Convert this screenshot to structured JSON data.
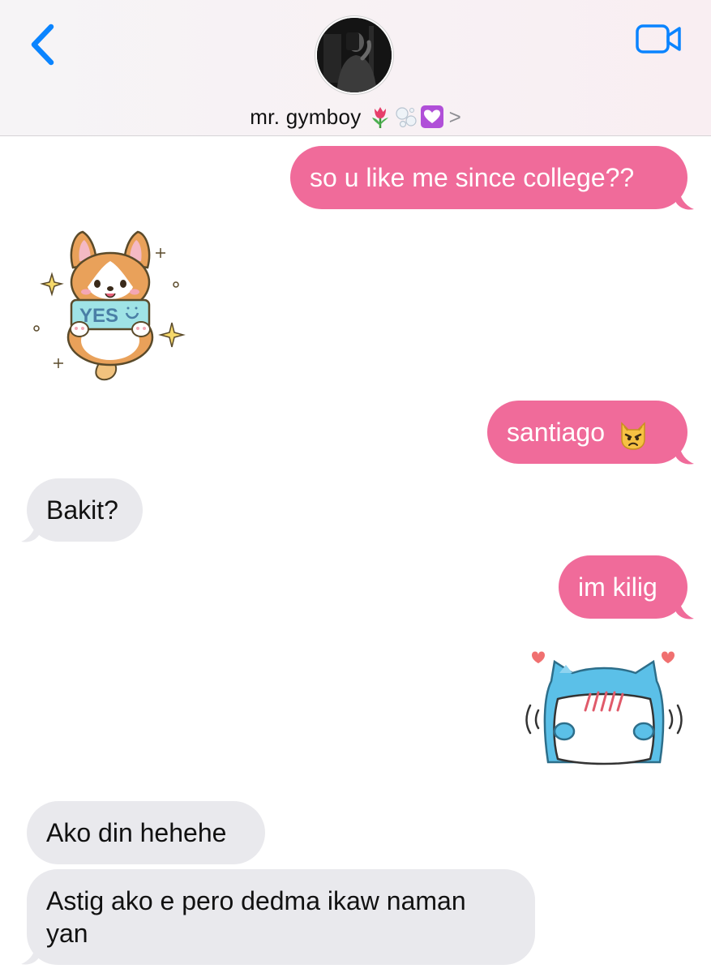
{
  "header": {
    "back_icon": "chevron-left-icon",
    "video_icon": "video-camera-icon",
    "contact_name": "mr. gymboy",
    "contact_emoji_icons": [
      "tulip-icon",
      "bubbles-icon",
      "heart-decoration-icon"
    ],
    "contact_chevron": ">"
  },
  "colors": {
    "sent_bubble": "#f06b9a",
    "received_bubble": "#e9e9ed",
    "accent_blue": "#0a84ff"
  },
  "messages": [
    {
      "direction": "sent",
      "text": "so u like me since college??"
    },
    {
      "direction": "received",
      "sticker": "corgi-yes-sticker",
      "sticker_text": "YES"
    },
    {
      "direction": "sent",
      "text": "santiago",
      "emoji_icon": "pouting-cat-icon"
    },
    {
      "direction": "received",
      "text": "Bakit?"
    },
    {
      "direction": "sent",
      "text": "im kilig"
    },
    {
      "direction": "sent",
      "sticker": "blue-cat-pillow-sticker"
    },
    {
      "direction": "received",
      "text": "Ako din hehehe"
    },
    {
      "direction": "received",
      "text_line1": "Astig ako e pero dedma ikaw naman",
      "text_line2": "yan"
    }
  ]
}
